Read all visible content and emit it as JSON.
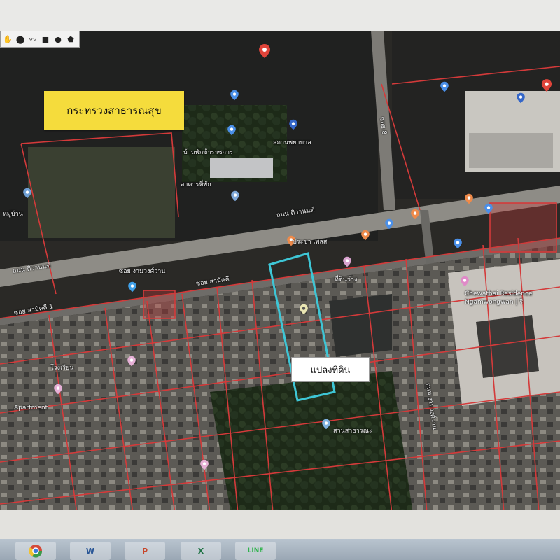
{
  "toolbar": {
    "tools": [
      {
        "name": "hand-tool",
        "glyph": "✋"
      },
      {
        "name": "marker-tool",
        "glyph": "⬤"
      },
      {
        "name": "polyline-tool",
        "glyph": "〰"
      },
      {
        "name": "rectangle-tool",
        "glyph": "■"
      },
      {
        "name": "circle-tool",
        "glyph": "●"
      },
      {
        "name": "polygon-tool",
        "glyph": "⬟"
      }
    ]
  },
  "labels": {
    "ministry_box": "กระทรวงสาธารณสุข",
    "parcel_box": "แปลงที่ดิน",
    "pracha_place": "ประชา เพลส",
    "ngamwongwan_hotel": "Chewathai Residence Ngamwongwan | รี",
    "soi_label": "ซอย งามวงศ์วาน",
    "vacant_land": "ที่ดินว่าง",
    "village_label": "หมู่บ้าน",
    "pin_a": "บ้านพักข้าราชการ",
    "pin_b": "สถานพยาบาล",
    "pin_c": "อาคารที่พัก",
    "apartment": "Apartment",
    "school": "โรงเรียน",
    "pin_d": "สวนสาธารณะ"
  },
  "roads": {
    "main_road": "ถนน ติวานนท์",
    "secondary_road": "ซอย สามัคคี",
    "vertical_road": "ถนน งามวงศ์วาน",
    "soi_a": "ซอย สามัคคี 1",
    "soi_b": "ซอย 8"
  },
  "taskbar": {
    "apps": [
      {
        "name": "chrome",
        "label": "",
        "color": "#d44a3a"
      },
      {
        "name": "word",
        "label": "W",
        "color": "#2b5797"
      },
      {
        "name": "powerpoint",
        "label": "P",
        "color": "#c7462b"
      },
      {
        "name": "excel",
        "label": "X",
        "color": "#1f7244"
      },
      {
        "name": "line",
        "label": "LINE",
        "color": "#2fb24c"
      }
    ]
  },
  "colors": {
    "parcel_lines": "#d43a3a",
    "highlight_parcel": "#3ec6d6",
    "label_yellow": "#f5dc3c"
  }
}
